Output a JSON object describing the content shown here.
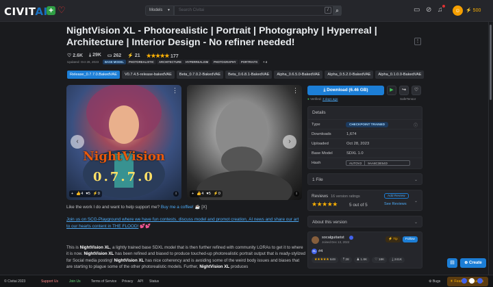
{
  "colors": {
    "accent": "#1c7ed6",
    "bg": "#1a1b1e",
    "panel": "#25262b",
    "star": "#fab005",
    "green": "#40c057"
  },
  "header": {
    "logo_main": "CIVIT",
    "logo_ai": "AI",
    "search_select": "Models",
    "search_placeholder": "Search Civitai",
    "slash": "/",
    "buzz": "500",
    "icons": [
      "search-icon",
      "upload-icon",
      "eye-off-icon",
      "bell-icon",
      "avatar",
      "bolt-icon"
    ]
  },
  "model": {
    "title": "NightVision XL - Photorealistic | Portrait | Photography | Hyperreal | Architecture | Interior Design - No refiner needed!",
    "likes": "2.6K",
    "downloads": "29K",
    "comments": "262",
    "buzz_tips": "21",
    "rating_count": "177",
    "updated": "Updated: Oct 28, 2023",
    "tags": [
      "BASE MODEL",
      "PHOTOREALISTIC",
      "ARCHITECTURE",
      "HYPERREALISM",
      "PHOTOGRAPHY",
      "PORTRAITS",
      "+ 4"
    ]
  },
  "versions": [
    "Release_0.7.7.0.BakedVAE",
    "V0.7.4.5-release-bakedVAE",
    "Beta_0.7.0.2-BakedVAE",
    "Beta_0.6.8.1-BakedVAE",
    "Alpha_0.6.5.0-BakedVAE",
    "Alpha_0.5.2.0-BakedVAE",
    "Alpha_0.1.0.0-BakedVAE"
  ],
  "gallery": {
    "card1": {
      "overlay_title": "NightVision",
      "overlay_version": "0.7.7.0",
      "reacts": [
        "+",
        "4",
        "5",
        "0"
      ]
    },
    "card2": {
      "reacts": [
        "+",
        "4",
        "5",
        "0"
      ]
    }
  },
  "description": {
    "support_text": "Like the work I do and want to help support me?",
    "support_link": "Buy me a coffee!",
    "support_tail": "☕ [X]",
    "discord_link_1": "Join us on SCG-Playground where we have fun contests, discuss model and promot creation, AI news and share our art",
    "discord_link_2": "to our hearts content in THE FLOOD!",
    "hearts": "💕💕",
    "para_1": "This is ",
    "para_b1": "NightVision XL",
    "para_2": ", a lightly trained base SDXL model that is then further refined with community LORAs to get it to where it is now. ",
    "para_b2": "NightVision XL",
    "para_3": " has been refined and biased to produce touched-up photorealistic portrait output that is ready-stylized for Social media posting! ",
    "para_b3": "NightVision XL",
    "para_4": " has nice coherency and is avoiding some of the weird body issues and biases that are starting to plague some of the other photorealistic models. Further, ",
    "para_b4": "NightVision XL",
    "para_5": " produces"
  },
  "sidebar": {
    "download_label": "Download (6.46 GB)",
    "verified_text": "Verified:",
    "verified_link": "3 days ago",
    "safetensor": "SafeTensor",
    "details_header": "Details",
    "details": [
      {
        "key": "Type",
        "value": "CHECKPOINT TRAINED"
      },
      {
        "key": "Downloads",
        "value": "1,674"
      },
      {
        "key": "Uploaded",
        "value": "Oct 28, 2023"
      },
      {
        "key": "Base Model",
        "value": "SDXL 1.0"
      },
      {
        "key": "Hash",
        "algo": "AUTOV2",
        "value": "9AA8C3E54D"
      }
    ],
    "files_label": "1 File",
    "reviews_label": "Reviews",
    "reviews_count": "16 version ratings",
    "reviews_score": "5 out of 5",
    "add_review": "Add Review",
    "see_reviews": "See Reviews",
    "about_label": "About this version",
    "creator_name": "socalguitarist",
    "creator_joined": "Joined Dec 13, 2022",
    "tip_label": "Tip",
    "follow_label": "Follow",
    "creator_rank": "#4",
    "creator_stats": [
      "649",
      "28",
      "1.8K",
      "18K",
      "241K"
    ]
  },
  "footer": {
    "copyright": "© Civitai 2023",
    "support_us": "Support Us",
    "join_us": "Join Us",
    "links": [
      "Terms of Service",
      "Privacy",
      "API",
      "Status"
    ],
    "bugs": "Bugs",
    "feature_requests": "Feature Requests",
    "create_label": "Create"
  }
}
